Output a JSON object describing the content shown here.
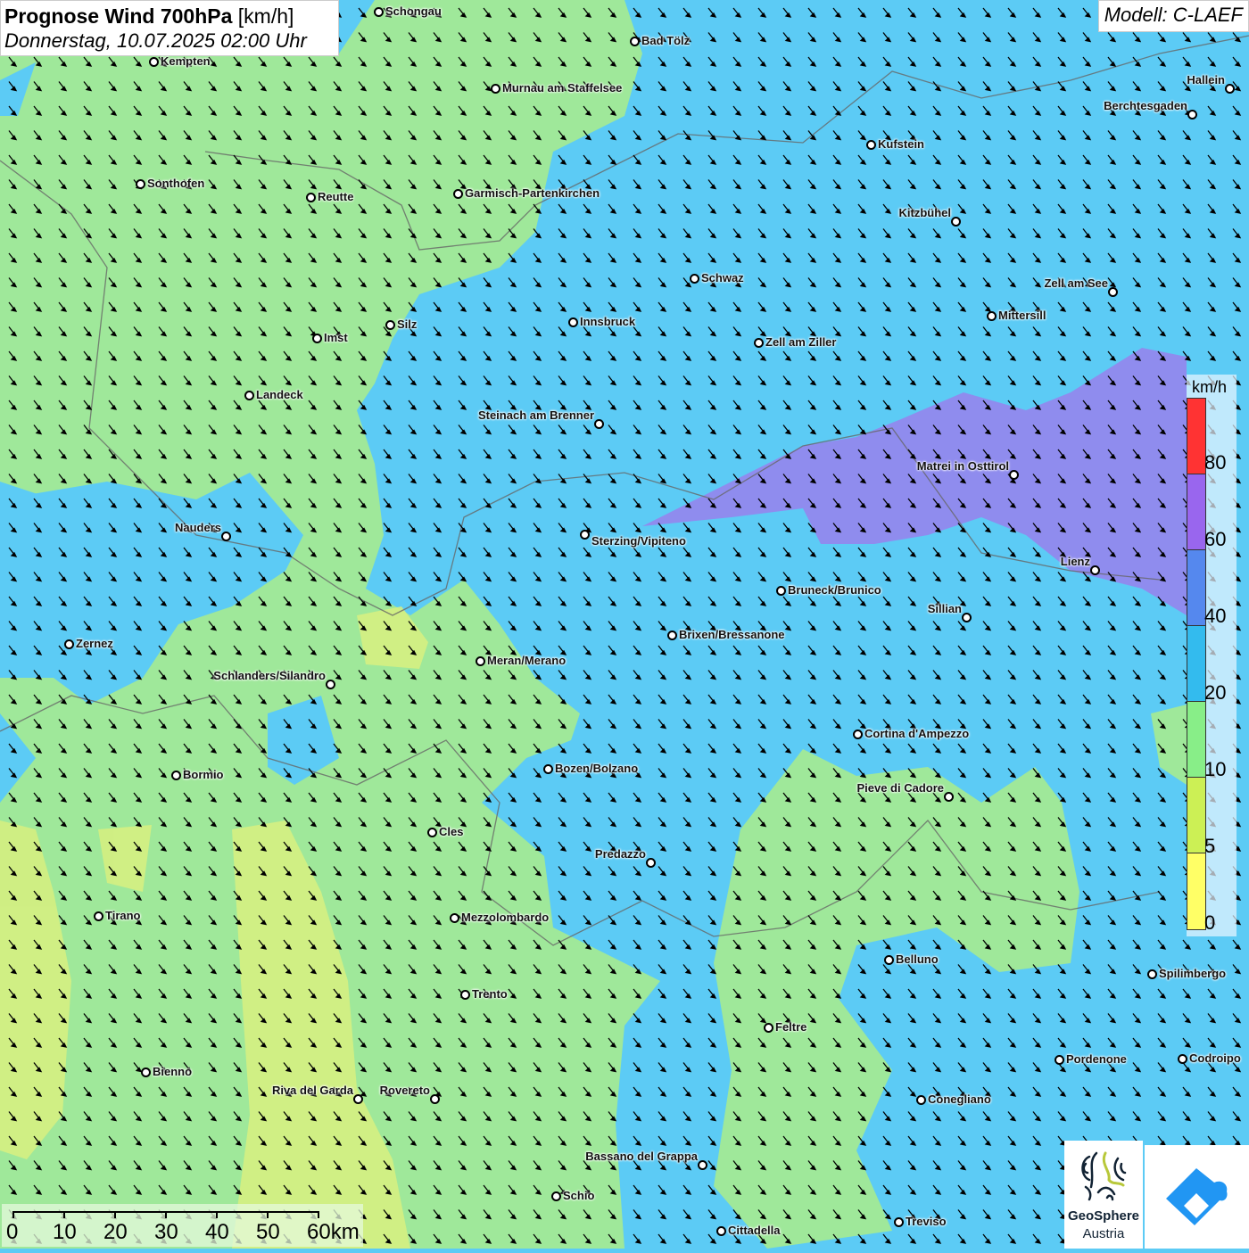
{
  "header": {
    "title": "Prognose Wind 700hPa",
    "unit": "[km/h]",
    "datetime": "Donnerstag, 10.07.2025 02:00 Uhr",
    "model": "Modell: C-LAEF"
  },
  "legend": {
    "unit": "km/h",
    "ticks": [
      "80",
      "60",
      "40",
      "20",
      "10",
      "5",
      "0"
    ],
    "colors": [
      "#ff3333",
      "#9966ee",
      "#5588ee",
      "#33bbee",
      "#88ee88",
      "#ccf055",
      "#ffff66"
    ]
  },
  "wind": {
    "direction": "north-west to south-east",
    "colors": {
      "blue": "#5ccbf5",
      "green": "#9fe89a",
      "yellow": "#d8f080",
      "purple": "#8f8cee"
    }
  },
  "cities": [
    "Schongau",
    "Bad Tölz",
    "Kempten",
    "Murnau am Staffelsee",
    "Hallein",
    "Berchtesgaden",
    "Kufstein",
    "Sonthofen",
    "Reutte",
    "Garmisch-Partenkirchen",
    "Kitzbühel",
    "Schwaz",
    "Zell am See",
    "Innsbruck",
    "Mittersill",
    "Silz",
    "Imst",
    "Zell am Ziller",
    "Landeck",
    "Steinach am Brenner",
    "Matrei in Osttirol",
    "Nauders",
    "Sterzing/Vipiteno",
    "Lienz",
    "Bruneck/Brunico",
    "Sillian",
    "Brixen/Bressanone",
    "Zernez",
    "Meran/Merano",
    "Schlanders/Silandro",
    "Cortina d'Ampezzo",
    "Bozen/Bolzano",
    "Bormio",
    "Pieve di Cadore",
    "Cles",
    "Predazzo",
    "Tirano",
    "Mezzolombardo",
    "Belluno",
    "Spilimbergo",
    "Trento",
    "Feltre",
    "Pordenone",
    "Codroipo",
    "Bienno",
    "Riva del Garda",
    "Rovereto",
    "Conegliano",
    "Bassano del Grappa",
    "Schio",
    "Treviso",
    "Cittadella"
  ],
  "scale": {
    "labels": [
      "0",
      "10",
      "20",
      "30",
      "40",
      "50",
      "60km"
    ]
  },
  "logos": {
    "geosphere_line1": "GeoSphere",
    "geosphere_line2": "Austria"
  }
}
